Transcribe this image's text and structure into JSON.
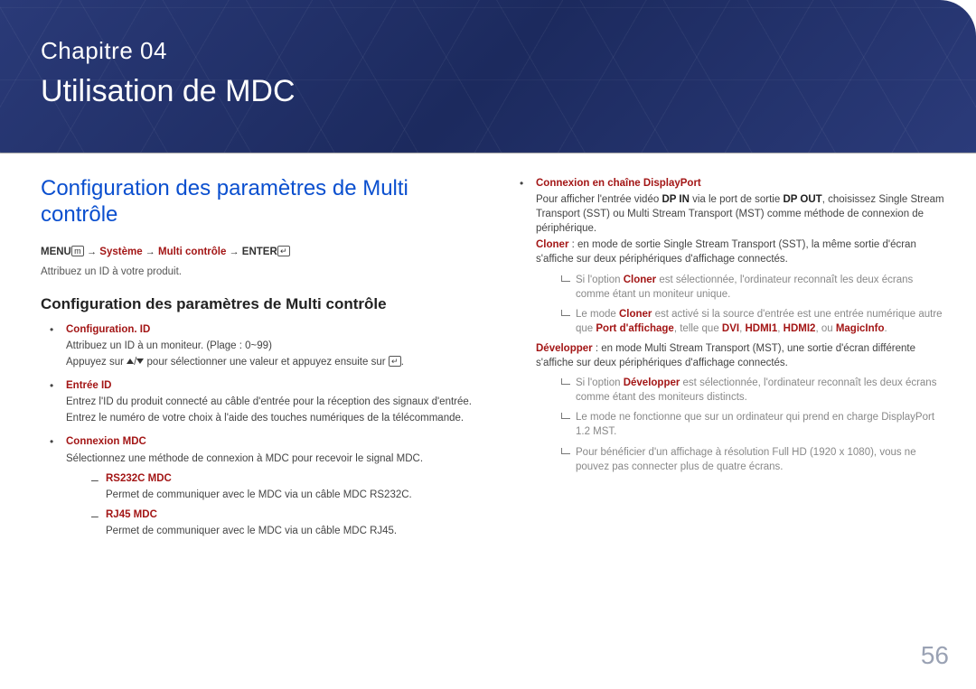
{
  "chapter": {
    "number": "Chapitre 04",
    "title": "Utilisation de MDC"
  },
  "heading_main": "Configuration des paramètres de Multi contrôle",
  "nav": {
    "menu": "MENU",
    "path1": "Système",
    "path2": "Multi contrôle",
    "enter": "ENTER"
  },
  "assign_note": "Attribuez un ID à votre produit.",
  "heading_sub": "Configuration des paramètres de Multi contrôle",
  "items_left": {
    "config_id": {
      "title": "Configuration. ID",
      "line1": "Attribuez un ID à un moniteur. (Plage : 0~99)",
      "line2a": "Appuyez sur ",
      "line2b": " pour sélectionner une valeur et appuyez ensuite sur "
    },
    "entree_id": {
      "title": "Entrée ID",
      "line1": "Entrez l'ID du produit connecté au câble d'entrée pour la réception des signaux d'entrée.",
      "line2": "Entrez le numéro de votre choix à l'aide des touches numériques de la télécommande."
    },
    "connexion_mdc": {
      "title": "Connexion MDC",
      "line1": "Sélectionnez une méthode de connexion à MDC pour recevoir le signal MDC.",
      "rs232c": {
        "title": "RS232C MDC",
        "body": "Permet de communiquer avec le MDC via un câble MDC RS232C."
      },
      "rj45": {
        "title": "RJ45 MDC",
        "body": "Permet de communiquer avec le MDC via un câble MDC RJ45."
      }
    }
  },
  "items_right": {
    "dp_chain": {
      "title": "Connexion en chaîne DisplayPort",
      "p1a": "Pour afficher l'entrée vidéo ",
      "dp_in": "DP IN",
      "p1b": " via le port de sortie ",
      "dp_out": "DP OUT",
      "p1c": ", choisissez Single Stream Transport (SST) ou Multi Stream Transport (MST) comme méthode de connexion de périphérique.",
      "cloner_label": "Cloner",
      "p2": " : en mode de sortie Single Stream Transport (SST), la même sortie d'écran s'affiche sur deux périphériques d'affichage connectés.",
      "tick1a": "Si l'option ",
      "tick1b": " est sélectionnée, l'ordinateur reconnaît les deux écrans comme étant un moniteur unique.",
      "tick2a": "Le mode ",
      "tick2b": " est activé si la source d'entrée est une entrée numérique autre que ",
      "port_aff": "Port d'affichage",
      "tick2c": ", telle que ",
      "dvi": "DVI",
      "hdmi1": "HDMI1",
      "hdmi2": "HDMI2",
      "ou": ", ou ",
      "magicinfo": "MagicInfo",
      "developper_label": "Développer",
      "p3": " : en mode Multi Stream Transport (MST), une sortie d'écran différente s'affiche sur deux périphériques d'affichage connectés.",
      "tick3a": "Si l'option ",
      "tick3b": " est sélectionnée, l'ordinateur reconnaît les deux écrans comme étant des moniteurs distincts.",
      "tick4": "Le mode ne fonctionne que sur un ordinateur qui prend en charge DisplayPort 1.2 MST.",
      "tick5": "Pour bénéficier d'un affichage à résolution Full HD (1920 x 1080), vous ne pouvez pas connecter plus de quatre écrans."
    }
  },
  "page_number": "56"
}
